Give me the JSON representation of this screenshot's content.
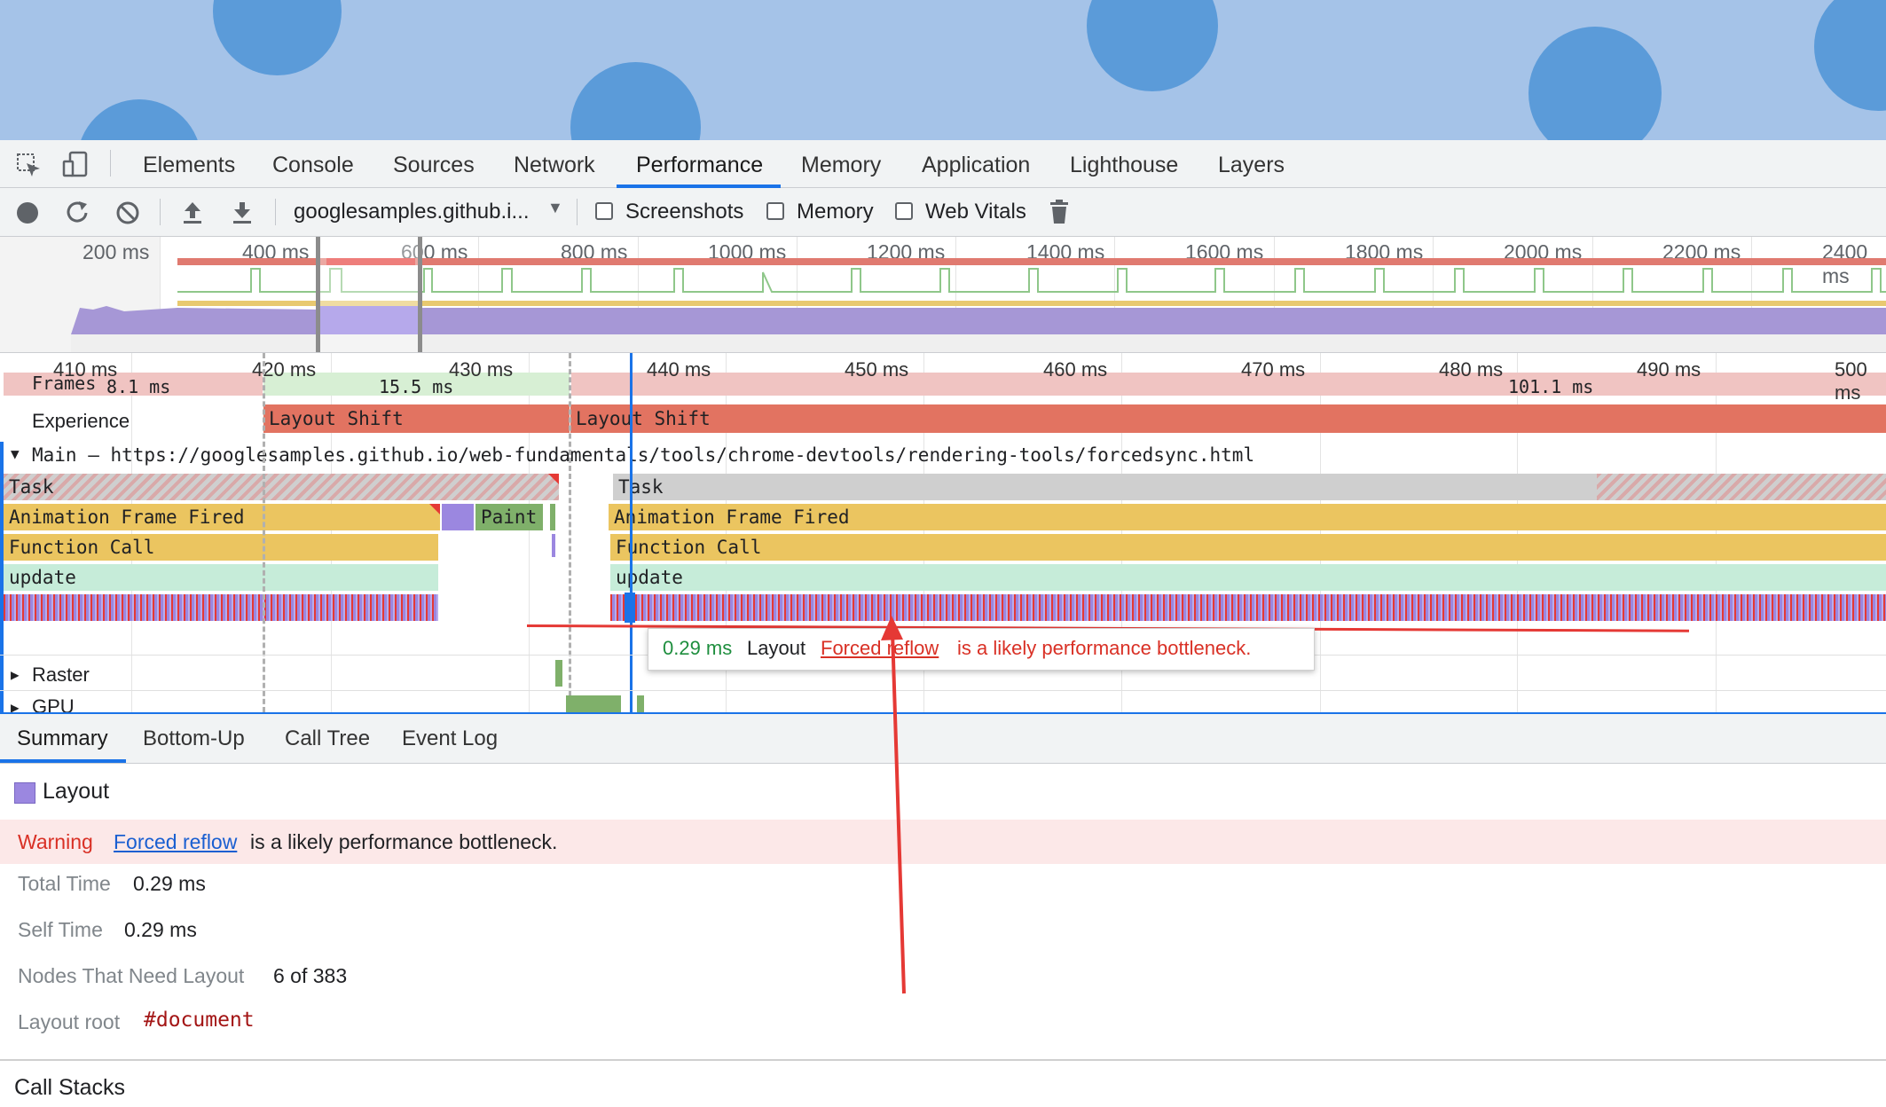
{
  "tabs": [
    "Elements",
    "Console",
    "Sources",
    "Network",
    "Performance",
    "Memory",
    "Application",
    "Lighthouse",
    "Layers"
  ],
  "active_tab": "Performance",
  "toolbar": {
    "url_select": "googlesamples.github.i...",
    "screenshots_label": "Screenshots",
    "memory_label": "Memory",
    "web_vitals_label": "Web Vitals"
  },
  "overview": {
    "ticks": [
      "200 ms",
      "400 ms",
      "600 ms",
      "800 ms",
      "1000 ms",
      "1200 ms",
      "1400 ms",
      "1600 ms",
      "1800 ms",
      "2000 ms",
      "2200 ms",
      "2400 ms"
    ]
  },
  "flame": {
    "ticks": [
      "410 ms",
      "420 ms",
      "430 ms",
      "440 ms",
      "450 ms",
      "460 ms",
      "470 ms",
      "480 ms",
      "490 ms",
      "500 ms"
    ],
    "frames_label": "Frames",
    "frame_times": [
      "8.1 ms",
      "15.5 ms",
      "101.1 ms"
    ],
    "experience_label": "Experience",
    "layout_shift_1": "Layout Shift",
    "layout_shift_2": "Layout Shift",
    "main_label": "Main — https://googlesamples.github.io/web-fundamentals/tools/chrome-devtools/rendering-tools/forcedsync.html",
    "task_1": "Task",
    "task_2": "Task",
    "anim_1": "Animation Frame Fired",
    "anim_2": "Animation Frame Fired",
    "paint": "Paint",
    "func_1": "Function Call",
    "func_2": "Function Call",
    "update_1": "update",
    "update_2": "update",
    "raster_label": "Raster",
    "gpu_label": "GPU"
  },
  "tooltip": {
    "time": "0.29 ms",
    "name": "Layout",
    "link": "Forced reflow",
    "message": "is a likely performance bottleneck."
  },
  "bottom_tabs": [
    "Summary",
    "Bottom-Up",
    "Call Tree",
    "Event Log"
  ],
  "summary": {
    "title": "Layout",
    "warning_label": "Warning",
    "warning_link": "Forced reflow",
    "warning_text": "is a likely performance bottleneck.",
    "total_time_label": "Total Time",
    "total_time": "0.29 ms",
    "self_time_label": "Self Time",
    "self_time": "0.29 ms",
    "nodes_label": "Nodes That Need Layout",
    "nodes_value": "6 of 383",
    "layout_root_label": "Layout root",
    "layout_root_value": "#document",
    "call_stacks": "Call Stacks"
  },
  "colors": {
    "accent": "#1a73e8",
    "layout": "#9b87e0",
    "task": "#cfcfcf",
    "animation": "#ebc560",
    "update": "#c6ecd9",
    "layout_shift": "#e27361",
    "warning": "#d93025",
    "paint": "#7fb06a"
  }
}
